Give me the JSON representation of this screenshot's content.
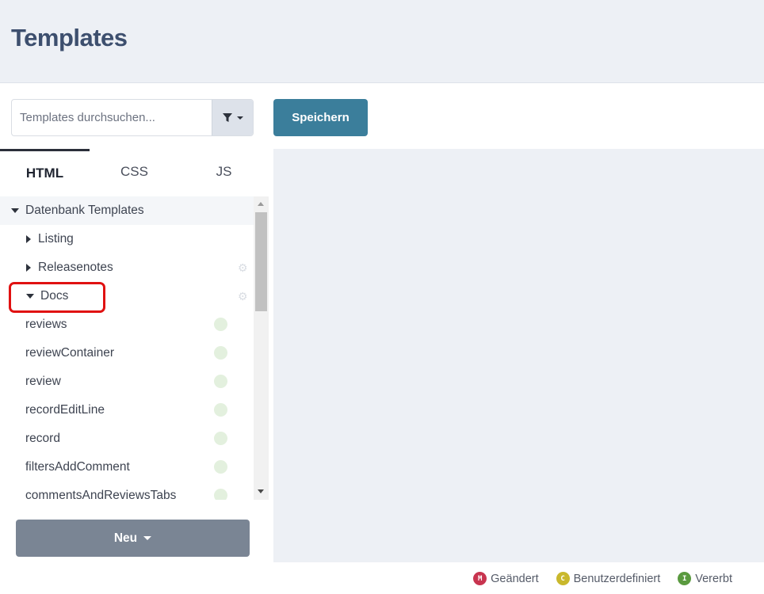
{
  "header": {
    "title": "Templates"
  },
  "toolbar": {
    "search_placeholder": "Templates durchsuchen...",
    "save_label": "Speichern"
  },
  "tabs": [
    {
      "label": "HTML",
      "active": true
    },
    {
      "label": "CSS",
      "active": false
    },
    {
      "label": "JS",
      "active": false
    }
  ],
  "tree": {
    "root": {
      "label": "Datenbank Templates",
      "expanded": true
    },
    "folders": [
      {
        "label": "Listing",
        "expanded": false
      },
      {
        "label": "Releasenotes",
        "expanded": false
      },
      {
        "label": "Docs",
        "expanded": true
      }
    ],
    "items": [
      {
        "label": "reviews",
        "badge": "I"
      },
      {
        "label": "reviewContainer",
        "badge": "I"
      },
      {
        "label": "review",
        "badge": "I"
      },
      {
        "label": "recordEditLine",
        "badge": "I"
      },
      {
        "label": "record",
        "badge": "I"
      },
      {
        "label": "filtersAddComment",
        "badge": "I"
      },
      {
        "label": "commentsAndReviewsTabs",
        "badge": "I"
      }
    ]
  },
  "new_button": {
    "label": "Neu"
  },
  "legend": [
    {
      "letter": "M",
      "label": "Geändert",
      "color": "#c8344f"
    },
    {
      "letter": "C",
      "label": "Benutzerdefiniert",
      "color": "#c9b82c"
    },
    {
      "letter": "I",
      "label": "Vererbt",
      "color": "#5a9a3f"
    }
  ],
  "colors": {
    "accent": "#3b7e9b",
    "header_bg": "#edf0f5",
    "highlight": "#e01111"
  }
}
